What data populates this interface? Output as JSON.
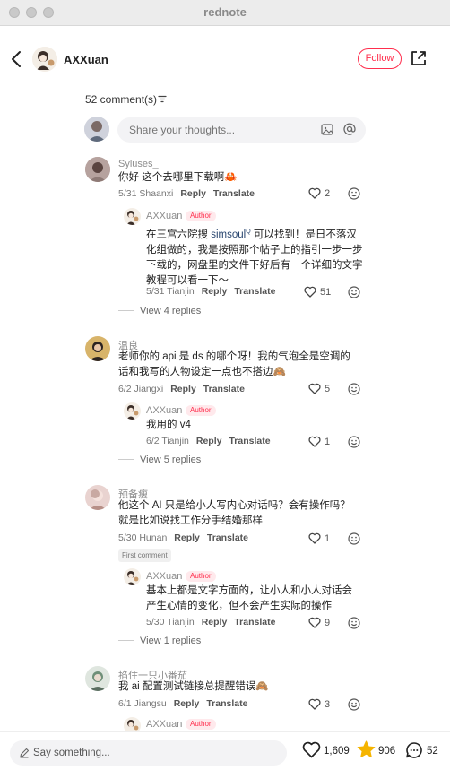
{
  "window": {
    "title": "rednote"
  },
  "header": {
    "author_name": "AXXuan",
    "follow_label": "Follow"
  },
  "comments_header": {
    "count_label": "52 comment(s)",
    "input_placeholder": "Share your thoughts..."
  },
  "comments": [
    {
      "user": "Syluses_",
      "text": "你好 这个去哪里下载啊🦀",
      "location_date": "5/31 Shaanxi",
      "reply_label": "Reply",
      "translate_label": "Translate",
      "likes": "2",
      "replies": [
        {
          "user": "AXXuan",
          "tag": "Author",
          "text_pre": "在三宫六院搜 ",
          "mention": "simsoul",
          "text_post": " 可以找到！是日不落汉化组做的，我是按照那个帖子上的指引一步一步下载的，网盘里的文件下好后有一个详细的文字教程可以看一下～",
          "location_date": "5/31 Tianjin",
          "likes": "51"
        }
      ],
      "view_replies": "View 4 replies"
    },
    {
      "user": "温良",
      "text": "老师你的 api 是 ds 的哪个呀！我的气泡全是空调的话和我写的人物设定一点也不搭边🙈",
      "location_date": "6/2 Jiangxi",
      "reply_label": "Reply",
      "translate_label": "Translate",
      "likes": "5",
      "replies": [
        {
          "user": "AXXuan",
          "tag": "Author",
          "text": "我用的 v4",
          "location_date": "6/2 Tianjin",
          "likes": "1"
        }
      ],
      "view_replies": "View 5 replies"
    },
    {
      "user": "预备瘦",
      "text": "他这个 AI 只是给小人写内心对话吗？会有操作吗？就是比如说找工作分手结婚那样",
      "location_date": "5/30 Hunan",
      "reply_label": "Reply",
      "translate_label": "Translate",
      "likes": "1",
      "badge": "First comment",
      "replies": [
        {
          "user": "AXXuan",
          "tag": "Author",
          "text": "基本上都是文字方面的，让小人和小人对话会产生心情的变化，但不会产生实际的操作",
          "location_date": "5/30 Tianjin",
          "likes": "9"
        }
      ],
      "view_replies": "View 1 replies"
    },
    {
      "user": "掐住一只小番茄",
      "text": "我 ai 配置测试链接总提醒错误🙈",
      "location_date": "6/1 Jiangsu",
      "reply_label": "Reply",
      "translate_label": "Translate",
      "likes": "3",
      "replies": [
        {
          "user": "AXXuan",
          "tag": "Author"
        }
      ]
    }
  ],
  "bottom_bar": {
    "say_placeholder": "Say something...",
    "likes": "1,609",
    "stars": "906",
    "comments": "52"
  },
  "colors": {
    "accent": "#ff2e4d",
    "tag_bg": "#ffe9ec",
    "star": "#f5b400"
  }
}
